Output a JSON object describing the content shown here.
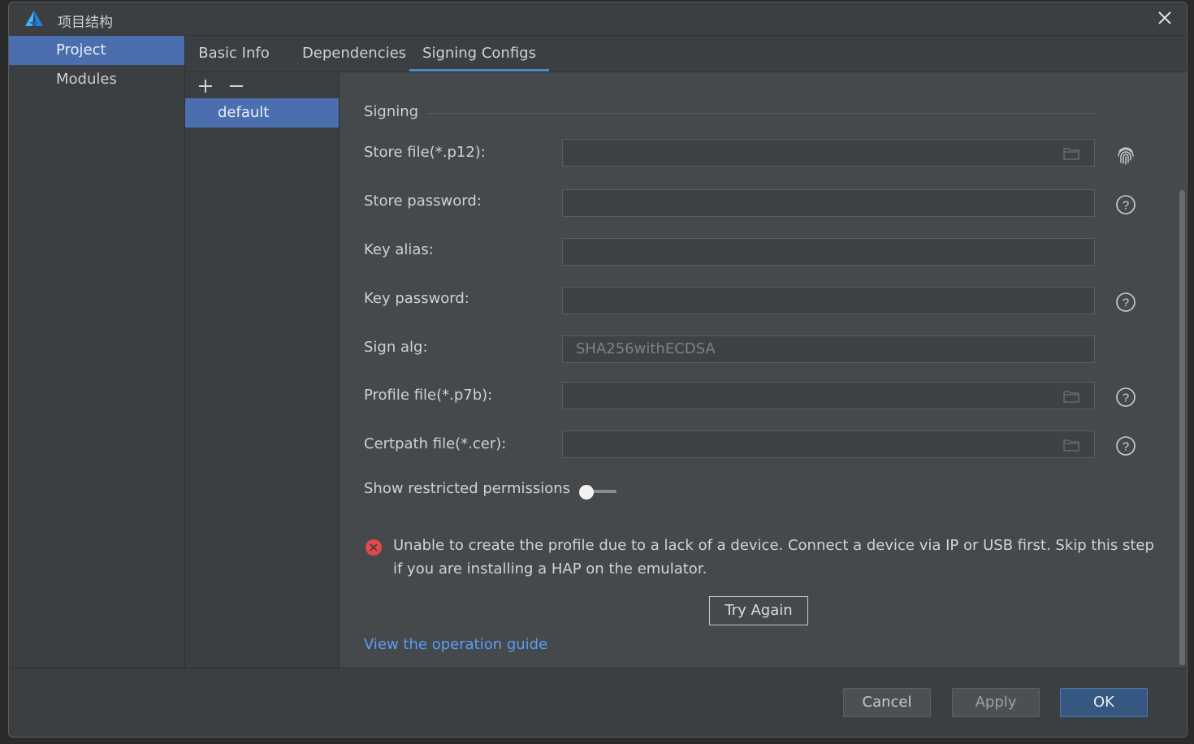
{
  "window": {
    "title": "项目结构"
  },
  "nav": {
    "items": [
      {
        "label": "Project"
      },
      {
        "label": "Modules"
      }
    ]
  },
  "tabs": [
    {
      "label": "Basic Info"
    },
    {
      "label": "Dependencies"
    },
    {
      "label": "Signing Configs"
    }
  ],
  "configs": {
    "items": [
      {
        "label": "default"
      }
    ]
  },
  "signing": {
    "section_title": "Signing",
    "fields": [
      {
        "label": "Store file(*.p12):",
        "value": ""
      },
      {
        "label": "Store password:",
        "value": ""
      },
      {
        "label": "Key alias:",
        "value": ""
      },
      {
        "label": "Key password:",
        "value": ""
      },
      {
        "label": "Sign alg:",
        "value": "SHA256withECDSA"
      },
      {
        "label": "Profile file(*.p7b):",
        "value": ""
      },
      {
        "label": "Certpath file(*.cer):",
        "value": ""
      }
    ],
    "toggle_label": "Show restricted permissions",
    "toggle_on": false,
    "error_message": "Unable to create the profile due to a lack of a device. Connect a device via IP or USB first. Skip this step if you are installing a HAP on the emulator.",
    "try_again_label": "Try Again",
    "guide_link": "View the operation guide"
  },
  "footer": {
    "cancel": "Cancel",
    "apply": "Apply",
    "ok": "OK"
  },
  "colors": {
    "accent": "#4b6eaf",
    "link": "#589df6",
    "error": "#e5484d",
    "ok_button": "#365880"
  }
}
